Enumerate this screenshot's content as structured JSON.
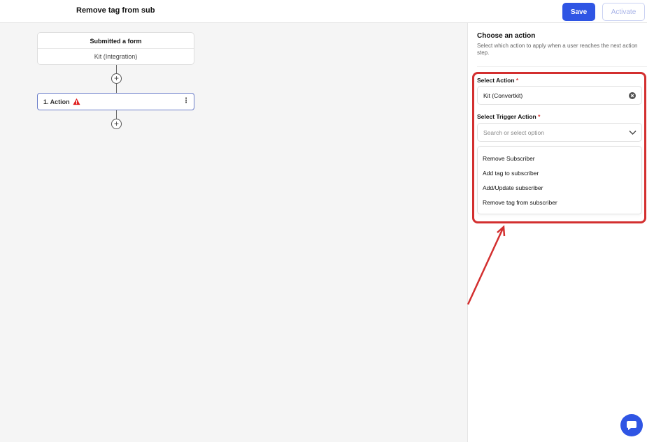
{
  "header": {
    "title": "Remove tag from sub",
    "save_label": "Save",
    "activate_label": "Activate"
  },
  "workflow": {
    "trigger_title": "Submitted a form",
    "trigger_subtitle": "Kit (Integration)",
    "action_label": "1. Action",
    "add_symbol": "+"
  },
  "panel": {
    "title": "Choose an action",
    "description": "Select which action to apply when a user reaches the next action step.",
    "select_action_label": "Select Action",
    "select_action_value": "Kit (Convertkit)",
    "trigger_action_label": "Select Trigger Action",
    "trigger_action_placeholder": "Search or select option",
    "required_marker": "*",
    "options": [
      "Remove Subscriber",
      "Add tag to subscriber",
      "Add/Update subscriber",
      "Remove tag from subscriber"
    ]
  },
  "colors": {
    "primary": "#2f55e4",
    "highlight": "#d32f2f",
    "warning": "#e02020"
  },
  "icons": {
    "warning": "warning-icon",
    "kebab": "kebab-menu-icon",
    "clear": "clear-icon",
    "chevron": "chevron-down-icon",
    "chat": "chat-icon"
  }
}
